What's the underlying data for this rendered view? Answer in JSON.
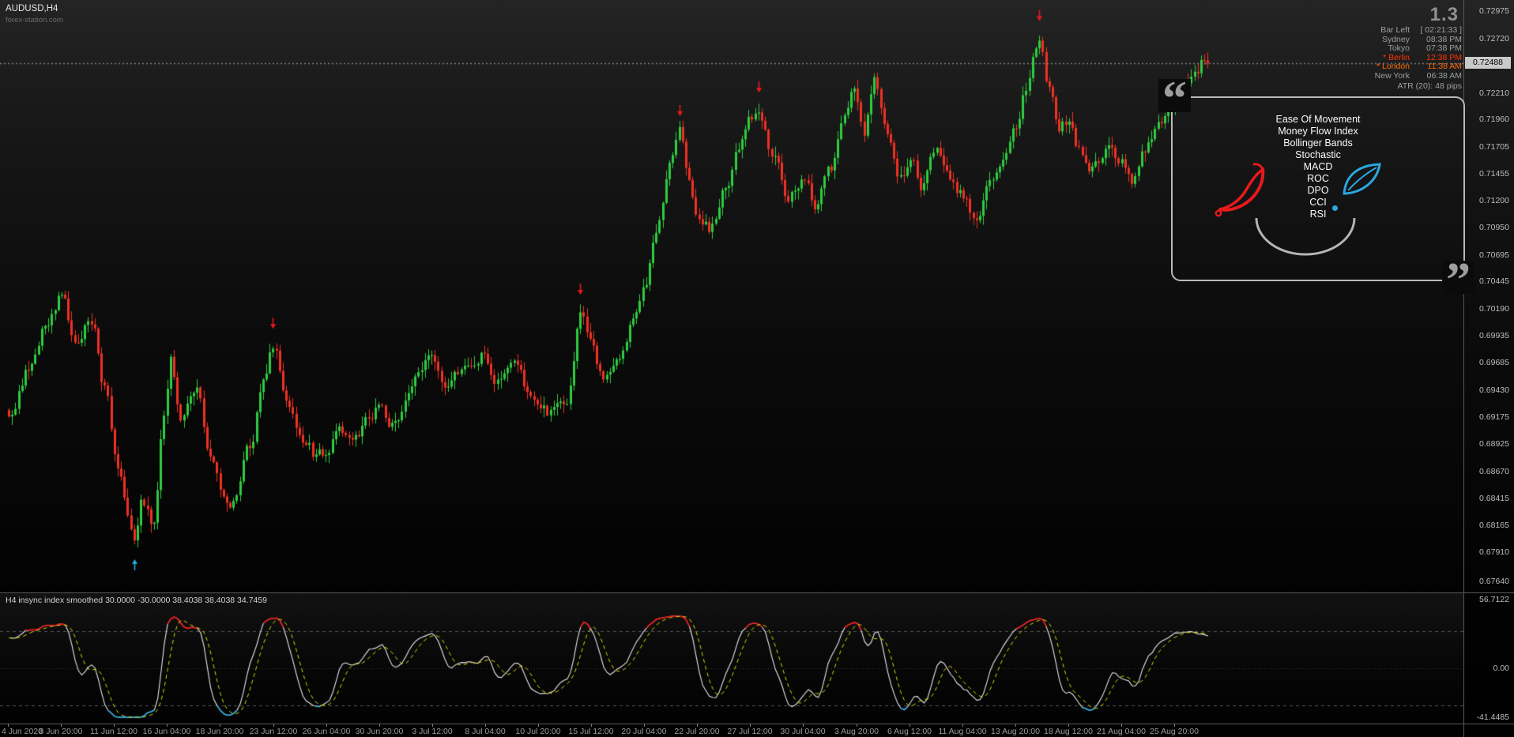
{
  "window": {
    "symbol_period": "AUDUSD,H4",
    "watermark_site": "forex-station.com"
  },
  "sessions": {
    "big_number": "1.3",
    "rows": [
      {
        "name": "Bar Left",
        "value": "[ 02:21:33 ]",
        "color": "#9aa0a0"
      },
      {
        "name": "Sydney",
        "value": "08:38 PM",
        "color": "#9aa0a0"
      },
      {
        "name": "Tokyo",
        "value": "07:38 PM",
        "color": "#9aa0a0"
      },
      {
        "name": "* Berlin",
        "value": "12:38 PM",
        "color": "#ff3400"
      },
      {
        "name": "* London",
        "value": "11:38 AM",
        "color": "#ff6a00"
      },
      {
        "name": "New York",
        "value": "06:38 AM",
        "color": "#9aa0a0"
      }
    ],
    "atr_label": "ATR (20): 48 pips"
  },
  "price_scale": {
    "current_price": "0.72488",
    "labels": [
      "0.72975",
      "0.72720",
      "0.72210",
      "0.71960",
      "0.71705",
      "0.71455",
      "0.71200",
      "0.70950",
      "0.70695",
      "0.70445",
      "0.70190",
      "0.69935",
      "0.69685",
      "0.69430",
      "0.69175",
      "0.68925",
      "0.68670",
      "0.68415",
      "0.68165",
      "0.67910",
      "0.67640"
    ]
  },
  "logo_box": {
    "quote_open": "“",
    "quote_close": "”",
    "indicators": [
      "Ease Of Movement",
      "Money Flow Index",
      "Bollinger Bands",
      "Stochastic",
      "MACD",
      "ROC",
      "DPO",
      "CCI",
      "RSI"
    ],
    "icons": [
      "chili-icon",
      "leaf-icon",
      "dot-icon",
      "bowl-icon"
    ],
    "border_color": "#b9b9b9"
  },
  "indicator_panel": {
    "title": "H4 insync index smoothed 30.0000 -30.0000 38.4038 38.4038 34.7459",
    "scale": {
      "max": "56.7122",
      "zero": "0.00",
      "min": "-41.4485"
    },
    "levels": [
      30,
      -30
    ],
    "colors": {
      "main": "#e8e8e8",
      "signal": "#dcdc00",
      "hot": "#e8191c",
      "cold": "#2ba8e0",
      "level": "#565656",
      "zero": "#3e3e3e"
    }
  },
  "time_axis": {
    "labels": [
      "4 Jun 2020",
      "8 Jun 20:00",
      "11 Jun 12:00",
      "16 Jun 04:00",
      "18 Jun 20:00",
      "23 Jun 12:00",
      "26 Jun 04:00",
      "30 Jun 20:00",
      "3 Jul 12:00",
      "8 Jul 04:00",
      "10 Jul 20:00",
      "15 Jul 12:00",
      "20 Jul 04:00",
      "22 Jul 20:00",
      "27 Jul 12:00",
      "30 Jul 04:00",
      "3 Aug 20:00",
      "6 Aug 12:00",
      "11 Aug 04:00",
      "13 Aug 20:00",
      "18 Aug 12:00",
      "21 Aug 04:00",
      "25 Aug 20:00"
    ]
  },
  "chart_data": {
    "type": "candlestick",
    "symbol": "AUDUSD",
    "timeframe": "H4",
    "bars": 364,
    "last_price": 0.72488,
    "price_axis": {
      "top": 0.72975,
      "bottom": 0.6764
    },
    "colors": {
      "bull": "#2ecc40",
      "bear": "#ef3124",
      "bid_line": "#8c9196"
    },
    "anchors": [
      [
        0,
        0.692
      ],
      [
        6,
        0.6963
      ],
      [
        12,
        0.7008
      ],
      [
        16,
        0.7031
      ],
      [
        20,
        0.6981
      ],
      [
        25,
        0.7008
      ],
      [
        29,
        0.6945
      ],
      [
        33,
        0.6873
      ],
      [
        36,
        0.683
      ],
      [
        38,
        0.6798
      ],
      [
        40,
        0.6838
      ],
      [
        44,
        0.6816
      ],
      [
        47,
        0.692
      ],
      [
        49,
        0.6972
      ],
      [
        52,
        0.6918
      ],
      [
        57,
        0.6945
      ],
      [
        61,
        0.6882
      ],
      [
        65,
        0.6841
      ],
      [
        68,
        0.6837
      ],
      [
        73,
        0.6891
      ],
      [
        77,
        0.6954
      ],
      [
        80,
        0.6985
      ],
      [
        84,
        0.6927
      ],
      [
        89,
        0.69
      ],
      [
        93,
        0.6882
      ],
      [
        96,
        0.6886
      ],
      [
        100,
        0.6909
      ],
      [
        105,
        0.69
      ],
      [
        109,
        0.6918
      ],
      [
        112,
        0.6927
      ],
      [
        116,
        0.6909
      ],
      [
        121,
        0.6936
      ],
      [
        125,
        0.6963
      ],
      [
        128,
        0.6977
      ],
      [
        132,
        0.6954
      ],
      [
        137,
        0.6963
      ],
      [
        141,
        0.6972
      ],
      [
        144,
        0.6977
      ],
      [
        148,
        0.695
      ],
      [
        153,
        0.6963
      ],
      [
        157,
        0.6945
      ],
      [
        160,
        0.6936
      ],
      [
        164,
        0.6922
      ],
      [
        169,
        0.6931
      ],
      [
        173,
        0.7017
      ],
      [
        176,
        0.699
      ],
      [
        179,
        0.6958
      ],
      [
        182,
        0.6954
      ],
      [
        185,
        0.6972
      ],
      [
        189,
        0.7008
      ],
      [
        192,
        0.7035
      ],
      [
        196,
        0.7089
      ],
      [
        201,
        0.7161
      ],
      [
        203,
        0.7184
      ],
      [
        206,
        0.7134
      ],
      [
        209,
        0.7103
      ],
      [
        212,
        0.7094
      ],
      [
        217,
        0.7134
      ],
      [
        221,
        0.717
      ],
      [
        225,
        0.7197
      ],
      [
        227,
        0.7206
      ],
      [
        231,
        0.7161
      ],
      [
        236,
        0.7125
      ],
      [
        241,
        0.7139
      ],
      [
        244,
        0.7112
      ],
      [
        249,
        0.7152
      ],
      [
        253,
        0.7206
      ],
      [
        256,
        0.7228
      ],
      [
        259,
        0.7188
      ],
      [
        262,
        0.7237
      ],
      [
        266,
        0.7179
      ],
      [
        270,
        0.7143
      ],
      [
        273,
        0.7161
      ],
      [
        276,
        0.7134
      ],
      [
        281,
        0.717
      ],
      [
        285,
        0.7139
      ],
      [
        289,
        0.7125
      ],
      [
        292,
        0.7098
      ],
      [
        297,
        0.7134
      ],
      [
        301,
        0.7161
      ],
      [
        305,
        0.7188
      ],
      [
        308,
        0.7224
      ],
      [
        312,
        0.7273
      ],
      [
        315,
        0.7224
      ],
      [
        318,
        0.7188
      ],
      [
        321,
        0.7197
      ],
      [
        324,
        0.717
      ],
      [
        328,
        0.7152
      ],
      [
        333,
        0.7166
      ],
      [
        337,
        0.7157
      ],
      [
        340,
        0.714
      ],
      [
        344,
        0.717
      ],
      [
        349,
        0.7197
      ],
      [
        353,
        0.7215
      ],
      [
        358,
        0.7233
      ],
      [
        362,
        0.7251
      ],
      [
        363,
        0.72488
      ]
    ],
    "arrows": [
      {
        "index": 38,
        "price": 0.6784,
        "dir": "up",
        "color": "#2ba8e0"
      },
      {
        "index": 80,
        "price": 0.7001,
        "dir": "down",
        "color": "#e8191c"
      },
      {
        "index": 173,
        "price": 0.7033,
        "dir": "down",
        "color": "#e8191c"
      },
      {
        "index": 203,
        "price": 0.72,
        "dir": "down",
        "color": "#e8191c"
      },
      {
        "index": 227,
        "price": 0.7222,
        "dir": "down",
        "color": "#e8191c"
      },
      {
        "index": 312,
        "price": 0.7289,
        "dir": "down",
        "color": "#e8191c"
      }
    ]
  }
}
